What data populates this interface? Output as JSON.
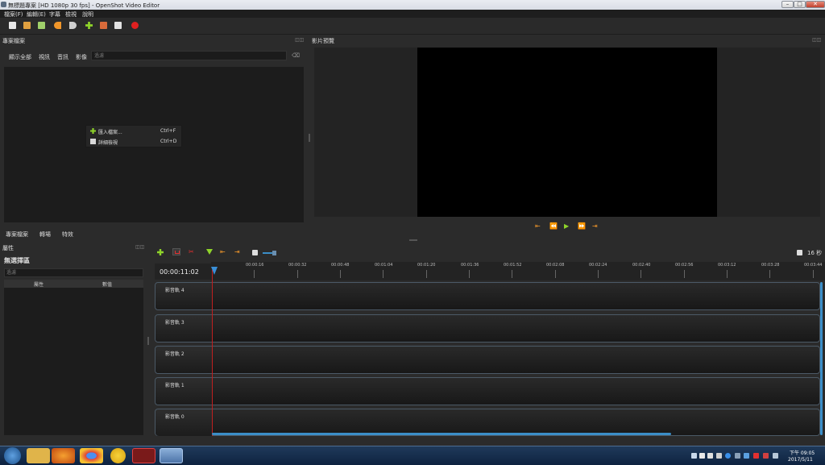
{
  "window": {
    "title": "無標題專案 [HD 1080p 30 fps] - OpenShot Video Editor",
    "min": "–",
    "max": "□",
    "close": "✕"
  },
  "menu": [
    "檔案(F)",
    "編輯(E)",
    "字幕",
    "檢視",
    "說明"
  ],
  "toolbar_icons": [
    "new-project-icon",
    "open-project-icon",
    "save-project-icon",
    "undo-icon",
    "redo-icon",
    "add-file-icon",
    "profile-icon",
    "export-icon",
    "record-icon"
  ],
  "files_panel": {
    "title": "專案檔案",
    "float": "◫◫",
    "tabs": [
      "顯示全部",
      "視訊",
      "音訊",
      "影像"
    ],
    "filter_placeholder": "過濾",
    "clear": "⌫",
    "context_menu": [
      {
        "label": "匯入檔案...",
        "shortcut": "Ctrl+F",
        "icon": "plus-icon"
      },
      {
        "label": "詳細檢視",
        "shortcut": "Ctrl+D",
        "icon": "details-view-icon"
      }
    ],
    "bottom_tabs": [
      "專案檔案",
      "轉場",
      "特效"
    ]
  },
  "preview_panel": {
    "title": "影片預覽",
    "float": "◫◫",
    "controls": [
      "⇤",
      "⏪",
      "▶",
      "⏩",
      "⇥"
    ]
  },
  "properties_panel": {
    "title": "屬性",
    "float": "◫◫",
    "selection": "無選擇區",
    "filter_placeholder": "過濾",
    "columns": [
      "屬性",
      "數值"
    ]
  },
  "timeline": {
    "current_time": "00:00:11:02",
    "zoom_label": "16 秒",
    "ruler_labels": [
      "00:00:16",
      "00:00:32",
      "00:00:48",
      "00:01:04",
      "00:01:20",
      "00:01:36",
      "00:01:52",
      "00:02:08",
      "00:02:24",
      "00:02:40",
      "00:02:56",
      "00:03:12",
      "00:03:28",
      "00:03:44"
    ],
    "tracks": [
      "影音軌 4",
      "影音軌 3",
      "影音軌 2",
      "影音軌 1",
      "影音軌 0"
    ],
    "tools": [
      "add-track-icon",
      "snap-icon",
      "razor-icon",
      "add-marker-icon",
      "previous-marker-icon",
      "next-marker-icon"
    ]
  },
  "taskbar": {
    "apps": [
      "start-button",
      "file-explorer-icon",
      "firefox-icon",
      "chrome-icon",
      "media-player-icon",
      "video-editor-icon",
      "openshot-icon"
    ],
    "time": "下午 09:05",
    "date": "2017/5/11"
  },
  "colors": {
    "accent_orange": "#f0962a",
    "accent_green": "#8fd42a",
    "accent_blue": "#3b8ec8",
    "playhead_red": "#c02020"
  }
}
